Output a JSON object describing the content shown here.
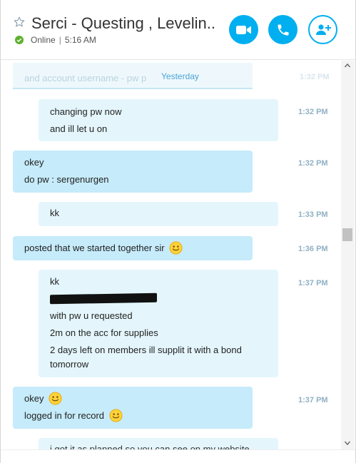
{
  "header": {
    "title": "Serci - Questing , Levelin...",
    "status": "Online",
    "time": "5:16 AM",
    "accent_color": "#00aff0",
    "status_color": "#5fb12f",
    "icons": [
      "star-icon",
      "video-call-icon",
      "phone-icon",
      "add-person-icon"
    ]
  },
  "chat": {
    "date_separator": "Yesterday",
    "date_ghost_text": "and account username - pw p",
    "date_ghost_time": "1:32 PM",
    "messages": [
      {
        "from": "me",
        "lines": [
          "changing pw now",
          "and ill let u on"
        ],
        "time": "1:32 PM"
      },
      {
        "from": "them",
        "lines": [
          "okey",
          "do pw : sergenurgen"
        ],
        "time": "1:32 PM"
      },
      {
        "from": "me",
        "lines": [
          "kk"
        ],
        "time": "1:33 PM"
      },
      {
        "from": "them",
        "lines": [
          "posted that we started together sir"
        ],
        "time": "1:36 PM"
      },
      {
        "from": "me",
        "lines": [
          "kk",
          "with pw u requested",
          "2m on the acc for supplies",
          "2 days left on members ill supplit it with a bond tomorrow"
        ],
        "time": "1:37 PM"
      },
      {
        "from": "them",
        "lines": [
          "okey",
          "logged in for record"
        ],
        "time": "1:37 PM"
      },
      {
        "from": "me",
        "lines": [
          "i got it as planned so you can see on my website"
        ],
        "time": ""
      }
    ]
  },
  "colors": {
    "my_bubble": "#e4f6fc",
    "their_bubble": "#c6ebfa",
    "timestamp": "#8fb1c4"
  }
}
